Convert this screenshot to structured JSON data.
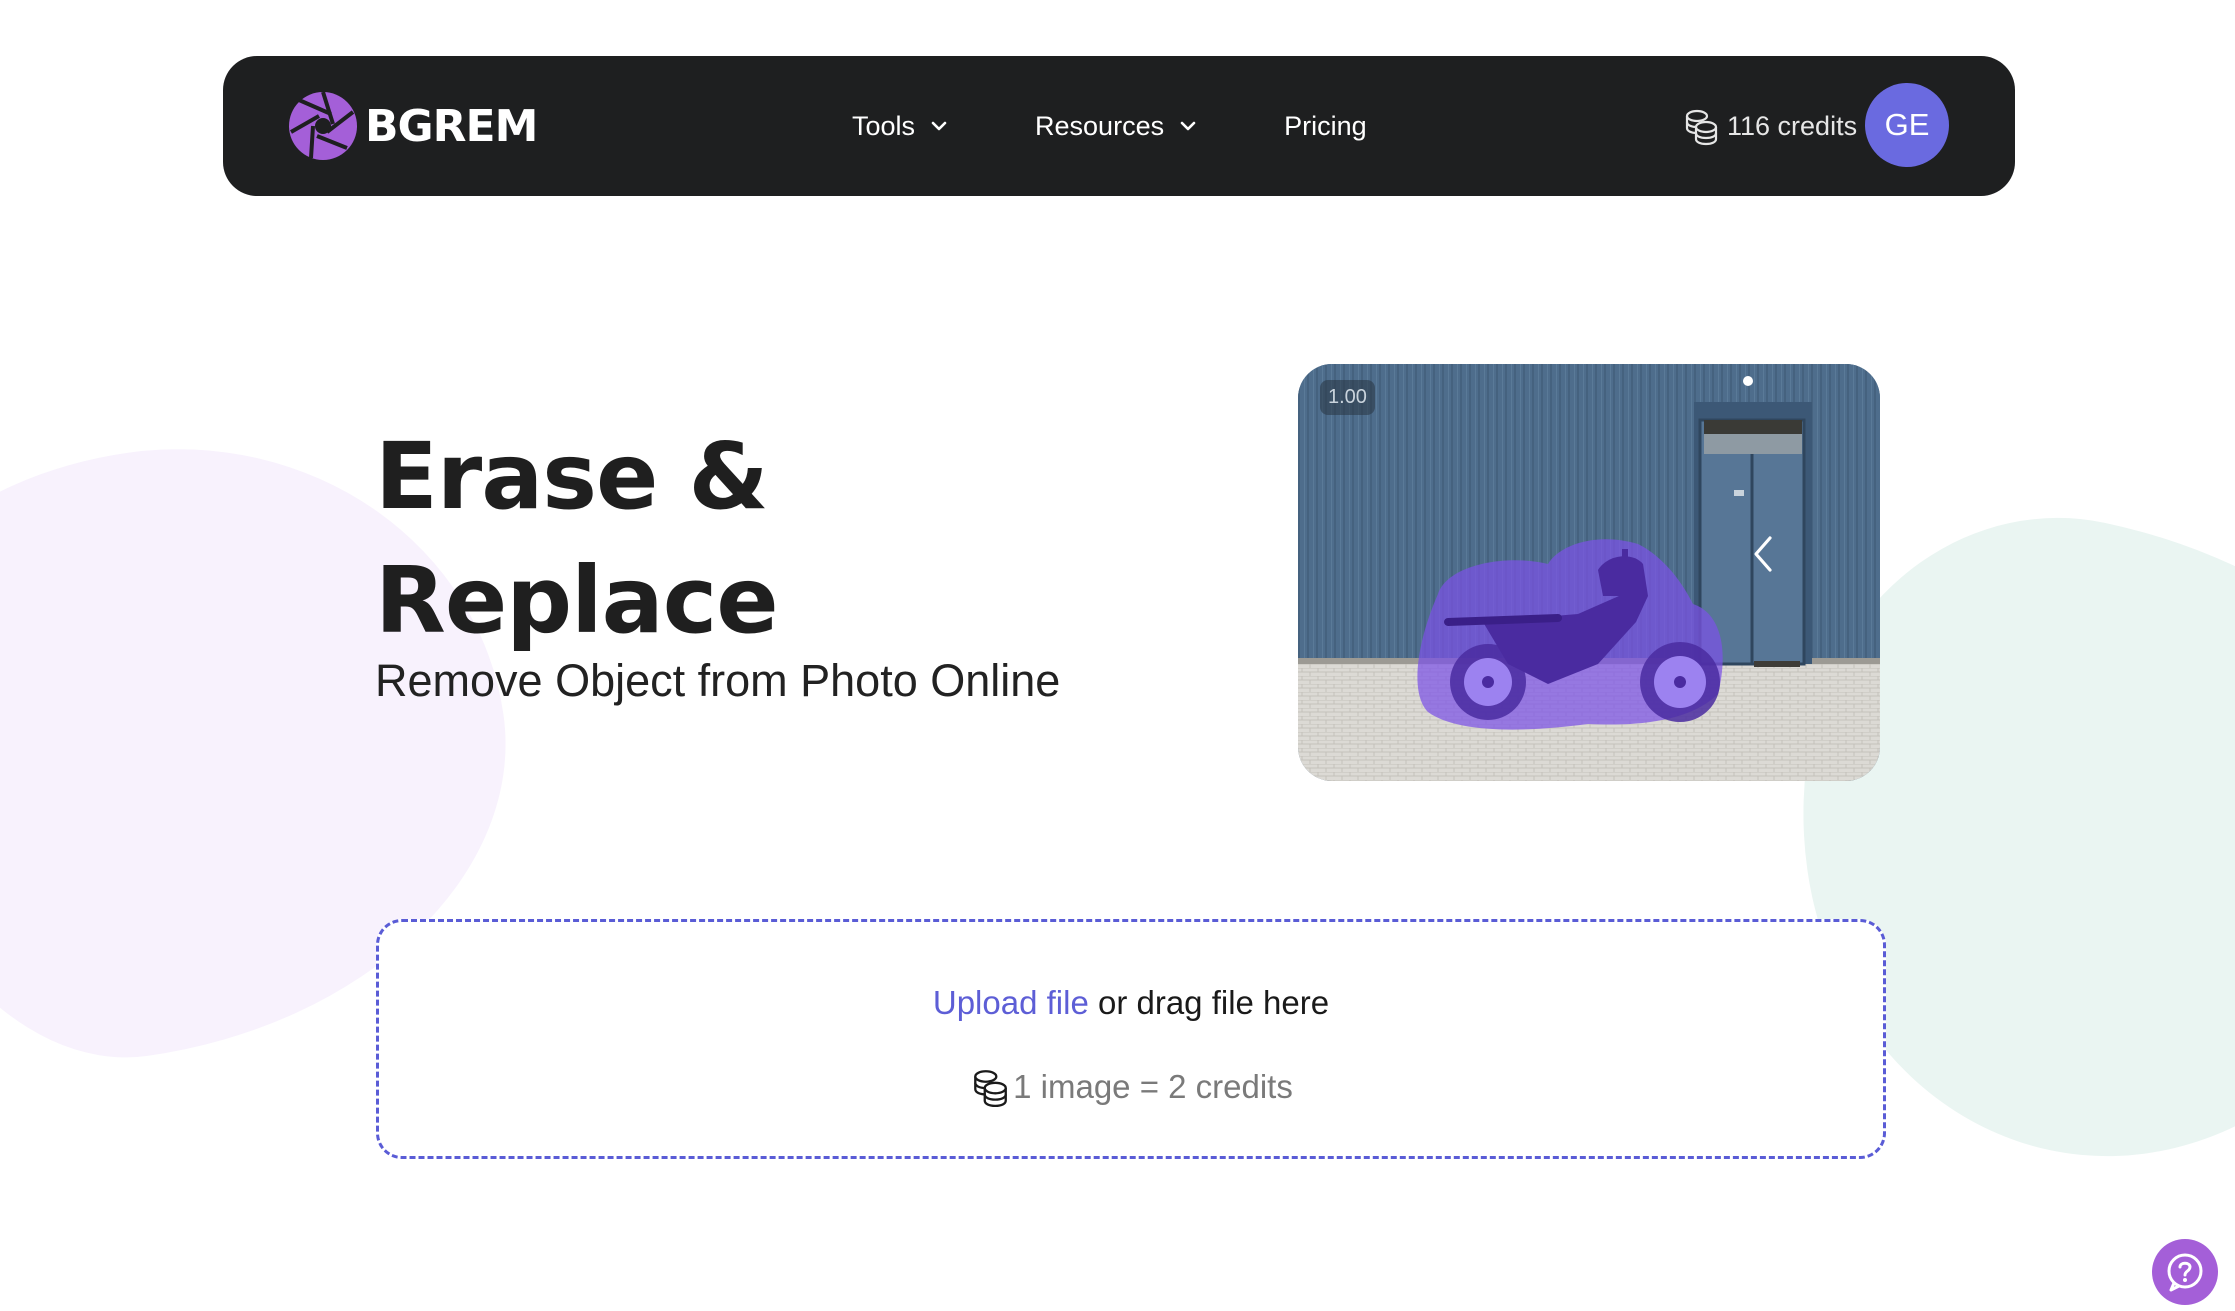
{
  "brand": {
    "name": "BGREM",
    "logo_color": "#a45fd8"
  },
  "nav": {
    "items": [
      {
        "label": "Tools",
        "has_dropdown": true
      },
      {
        "label": "Resources",
        "has_dropdown": true
      },
      {
        "label": "Pricing",
        "has_dropdown": false
      }
    ],
    "credits_label": "116 credits",
    "avatar_initials": "GE",
    "background": "#1e1f20"
  },
  "hero": {
    "title_line1": "Erase &",
    "title_line2": "Replace",
    "subtitle": "Remove Object from Photo Online"
  },
  "preview": {
    "zoom_badge": "1.00",
    "arrow_icon": "chevron-left-icon",
    "highlight_color": "#7b52e6"
  },
  "upload": {
    "link_text": "Upload file",
    "rest_text": " or drag file here",
    "cost_text": "1 image = 2 credits",
    "accent": "#5d5ed6"
  },
  "help": {
    "icon": "help-chat-icon"
  }
}
